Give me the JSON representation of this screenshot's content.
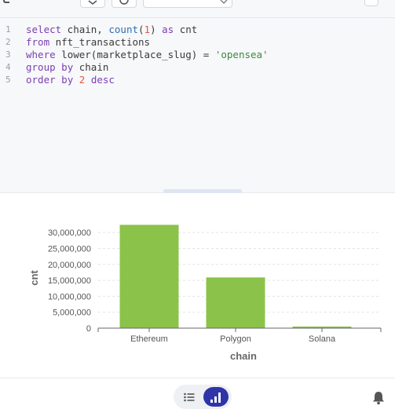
{
  "editor": {
    "lines": [
      {
        "number": "1",
        "tokens": [
          {
            "t": "select",
            "k": "kw"
          },
          {
            "t": " chain, "
          },
          {
            "t": "count",
            "k": "fn"
          },
          {
            "t": "("
          },
          {
            "t": "1",
            "k": "num"
          },
          {
            "t": ") "
          },
          {
            "t": "as",
            "k": "kw"
          },
          {
            "t": " cnt"
          }
        ]
      },
      {
        "number": "2",
        "tokens": [
          {
            "t": "from",
            "k": "kw"
          },
          {
            "t": " nft_transactions"
          }
        ]
      },
      {
        "number": "3",
        "tokens": [
          {
            "t": "where",
            "k": "kw"
          },
          {
            "t": " lower(marketplace_slug) = "
          },
          {
            "t": "'opensea'",
            "k": "str"
          }
        ]
      },
      {
        "number": "4",
        "tokens": [
          {
            "t": "group",
            "k": "kw"
          },
          {
            "t": " "
          },
          {
            "t": "by",
            "k": "kw"
          },
          {
            "t": " chain"
          }
        ]
      },
      {
        "number": "5",
        "tokens": [
          {
            "t": "order",
            "k": "kw"
          },
          {
            "t": " "
          },
          {
            "t": "by",
            "k": "kw"
          },
          {
            "t": " "
          },
          {
            "t": "2",
            "k": "num"
          },
          {
            "t": " "
          },
          {
            "t": "desc",
            "k": "kw"
          }
        ]
      }
    ]
  },
  "chart_data": {
    "type": "bar",
    "categories": [
      "Ethereum",
      "Polygon",
      "Solana"
    ],
    "values": [
      32400000,
      15900000,
      500000
    ],
    "xlabel": "chain",
    "ylabel": "cnt",
    "ylim": [
      0,
      32500000
    ],
    "yticks": [
      0,
      5000000,
      10000000,
      15000000,
      20000000,
      25000000,
      30000000
    ],
    "ytick_labels": [
      "0",
      "5,000,000",
      "10,000,000",
      "15,000,000",
      "20,000,000",
      "25,000,000",
      "30,000,000"
    ],
    "bar_color": "#8bc34a",
    "grid": true,
    "legend": false
  },
  "colors": {
    "accent": "#2f35a8",
    "bar": "#8bc34a"
  },
  "icons": {
    "list_toggle": "list-icon",
    "chart_toggle": "bar-chart-icon",
    "notifications": "bell-icon"
  }
}
